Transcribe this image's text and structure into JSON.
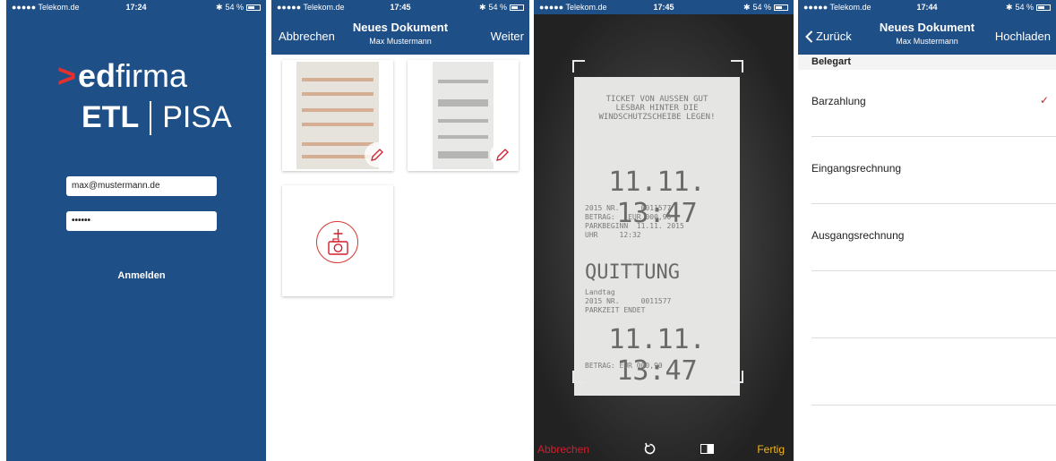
{
  "screens": [
    {
      "status": {
        "carrier": "●●●●● Telekom.de",
        "time": "17:24",
        "battery": "54 %"
      },
      "logo": {
        "chevron": ">",
        "brand_bold": "ed",
        "brand_rest": "firma",
        "etl": "ETL",
        "pisa": "PISA"
      },
      "email_value": "max@mustermann.de",
      "password_value": "••••••",
      "login_label": "Anmelden"
    },
    {
      "status": {
        "carrier": "●●●●● Telekom.de",
        "time": "17:45",
        "battery": "54 %"
      },
      "nav": {
        "left": "Abbrechen",
        "title": "Neues Dokument",
        "subtitle": "Max Mustermann",
        "right": "Weiter"
      }
    },
    {
      "status": {
        "carrier": "●●●●● Telekom.de",
        "time": "17:45",
        "battery": "54 %"
      },
      "receipt": {
        "header": "TICKET VON AUSSEN GUT\nLESBAR HINTER DIE\nWINDSCHUTZSCHEIBE LEGEN!",
        "big_time_1": "11.11. 13:47",
        "lines_1": "2015 NR.     0011577\nBETRAG:   EUR 000,90\nPARKBEGINN  11.11. 2015\nUHR     12:32",
        "title": "QUITTUNG",
        "lines_2": "Landtag\n2015 NR.     0011577\nPARKZEIT ENDET",
        "big_time_2": "11.11. 13:47",
        "amount": "BETRAG:   EUR 000,90"
      },
      "toolbar": {
        "cancel": "Abbrechen",
        "done": "Fertig"
      }
    },
    {
      "status": {
        "carrier": "●●●●● Telekom.de",
        "time": "17:44",
        "battery": "54 %"
      },
      "nav": {
        "left": "Zurück",
        "title": "Neues Dokument",
        "subtitle": "Max Mustermann",
        "right": "Hochladen"
      },
      "section": "Belegart",
      "options": [
        "Barzahlung",
        "Eingangsrechnung",
        "Ausgangsrechnung"
      ],
      "selected_check": "✓"
    }
  ],
  "colors": {
    "brand_blue": "#1f4f87",
    "accent_red": "#d21e2e",
    "done_yellow": "#f2b51c"
  }
}
